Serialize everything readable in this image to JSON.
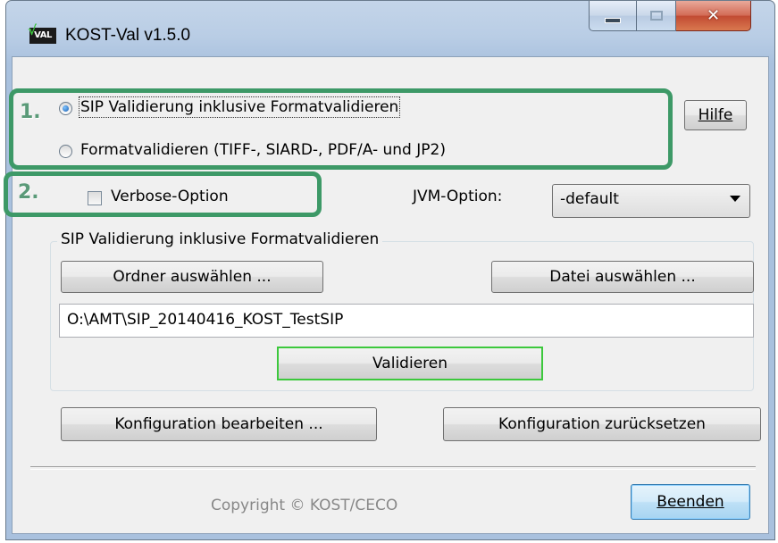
{
  "window": {
    "logo_text": "VAL",
    "title": "KOST-Val v1.5.0"
  },
  "options": {
    "radio_sip_label": "SIP Validierung inklusive Formatvalidieren",
    "radio_format_label": "Formatvalidieren (TIFF-, SIARD-, PDF/A- und JP2)",
    "selected": "sip",
    "help_button": "Hilfe",
    "verbose_label": "Verbose-Option",
    "verbose_checked": false,
    "jvm_label": "JVM-Option:",
    "jvm_value": "-default"
  },
  "group": {
    "title": "SIP Validierung inklusive Formatvalidieren",
    "folder_button": "Ordner auswählen ...",
    "file_button": "Datei auswählen ...",
    "path_value": "O:\\AMT\\SIP_20140416_KOST_TestSIP",
    "validate_button": "Validieren"
  },
  "config": {
    "edit_button": "Konfiguration bearbeiten ...",
    "reset_button": "Konfiguration zurücksetzen"
  },
  "footer": {
    "copyright": "Copyright © KOST/CECO",
    "quit_button": "Beenden"
  },
  "annotations": {
    "marker_1": "1.",
    "marker_2": "2.",
    "highlight_color": "#3d9967"
  }
}
